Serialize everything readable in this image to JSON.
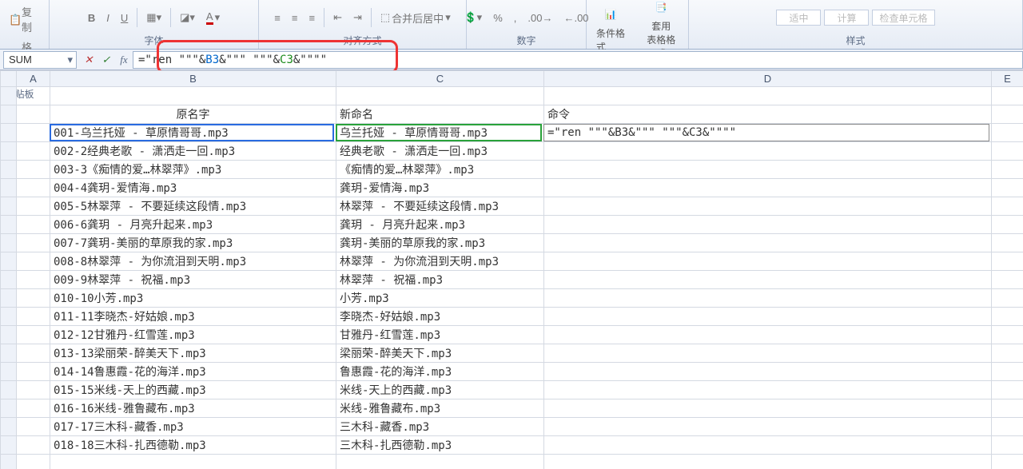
{
  "ribbon": {
    "copy_label": "复制",
    "format_painter": "格式刷",
    "paste_label": "贴板",
    "font_group": "字体",
    "align_group": "对齐方式",
    "merge_label": "合并后居中",
    "number_group": "数字",
    "cond_fmt": "条件格式",
    "apply_tbl": "套用\n表格格式",
    "style_group": "样式",
    "style_neutral": "适中",
    "style_calc": "计算",
    "check_cell": "检查单元格"
  },
  "formula_bar": {
    "name_box": "SUM",
    "formula_prefix": "=\"ren \"\"\"&",
    "formula_bref": "B3",
    "formula_mid": "&\"\"\" \"\"\"&",
    "formula_cref": "C3",
    "formula_suffix": "&\"\"\"\""
  },
  "columns": [
    "A",
    "B",
    "C",
    "D",
    "E"
  ],
  "active_col": "D",
  "headers": {
    "B": "原名字",
    "C": "新命名",
    "D": "命令"
  },
  "edit_cell_text": "=\"ren \"\"\"&B3&\"\"\" \"\"\"&C3&\"\"\"\"",
  "rows": [
    {
      "b": "001-乌兰托娅 - 草原情哥哥.mp3",
      "c": "乌兰托娅 - 草原情哥哥.mp3"
    },
    {
      "b": "002-2经典老歌 - 潇洒走一回.mp3",
      "c": "经典老歌 - 潇洒走一回.mp3"
    },
    {
      "b": "003-3《痴情的爱…林翠萍》.mp3",
      "c": "《痴情的爱…林翠萍》.mp3"
    },
    {
      "b": "004-4龚玥-爱情海.mp3",
      "c": "龚玥-爱情海.mp3"
    },
    {
      "b": "005-5林翠萍 - 不要延续这段情.mp3",
      "c": "林翠萍 - 不要延续这段情.mp3"
    },
    {
      "b": "006-6龚玥 - 月亮升起来.mp3",
      "c": "龚玥 - 月亮升起来.mp3"
    },
    {
      "b": "007-7龚玥-美丽的草原我的家.mp3",
      "c": "龚玥-美丽的草原我的家.mp3"
    },
    {
      "b": "008-8林翠萍 - 为你流泪到天明.mp3",
      "c": "林翠萍 - 为你流泪到天明.mp3"
    },
    {
      "b": "009-9林翠萍 - 祝福.mp3",
      "c": "林翠萍 - 祝福.mp3"
    },
    {
      "b": "010-10小芳.mp3",
      "c": "小芳.mp3"
    },
    {
      "b": "011-11李晓杰-好姑娘.mp3",
      "c": "李晓杰-好姑娘.mp3"
    },
    {
      "b": "012-12甘雅丹-红雪莲.mp3",
      "c": "甘雅丹-红雪莲.mp3"
    },
    {
      "b": "013-13梁丽荣-醉美天下.mp3",
      "c": "梁丽荣-醉美天下.mp3"
    },
    {
      "b": "014-14鲁惠霞-花的海洋.mp3",
      "c": "鲁惠霞-花的海洋.mp3"
    },
    {
      "b": "015-15米线-天上的西藏.mp3",
      "c": "米线-天上的西藏.mp3"
    },
    {
      "b": "016-16米线-雅鲁藏布.mp3",
      "c": "米线-雅鲁藏布.mp3"
    },
    {
      "b": "017-17三木科-藏香.mp3",
      "c": "三木科-藏香.mp3"
    },
    {
      "b": "018-18三木科-扎西德勒.mp3",
      "c": "三木科-扎西德勒.mp3"
    }
  ]
}
